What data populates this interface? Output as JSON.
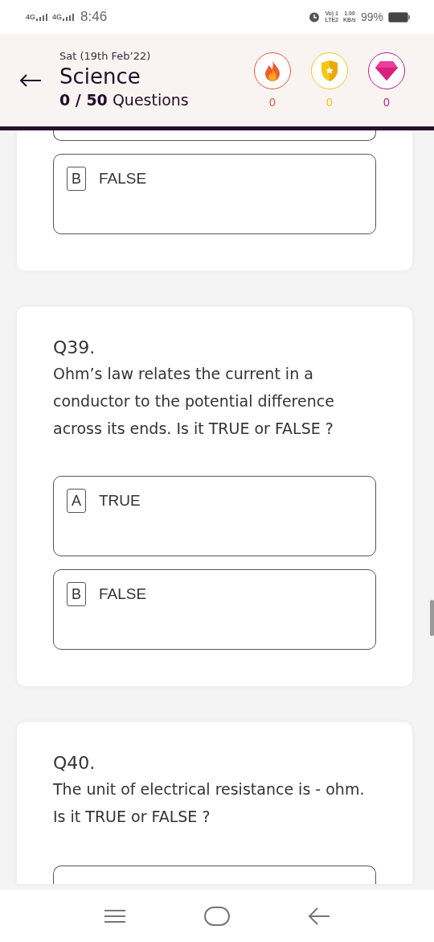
{
  "status_bar": {
    "network_1": "4G",
    "network_2": "4G",
    "time": "8:46",
    "volte": "Vo) 1",
    "lte": "LTE2",
    "speed": "1.00",
    "speed_unit": "KB/s",
    "battery": "99%"
  },
  "header": {
    "date": "Sat (19th Feb’22)",
    "subject": "Science",
    "progress": "**0 / 50** Questions",
    "badges": [
      {
        "kind": "fire",
        "count": "0",
        "color": "#e8553a"
      },
      {
        "kind": "shield",
        "count": "0",
        "color": "#f2c511"
      },
      {
        "kind": "gem",
        "count": "0",
        "color": "#c2188f"
      }
    ]
  },
  "cards": [
    {
      "options": [
        {
          "kind": "cut"
        },
        {
          "kind": "full",
          "letter": "B",
          "label": "FALSE"
        }
      ]
    },
    {
      "number": "Q39.",
      "text": "Ohm’s law relates the current in a conductor to the potential difference across its ends. Is it TRUE or FALSE ?",
      "options": [
        {
          "kind": "full",
          "letter": "A",
          "label": "TRUE"
        },
        {
          "kind": "full",
          "letter": "B",
          "label": "FALSE"
        }
      ]
    },
    {
      "number": "Q40.",
      "text": "The unit of electrical resistance is - ohm. Is it TRUE or FALSE ?",
      "options": [
        {
          "kind": "cut_top"
        }
      ]
    }
  ]
}
